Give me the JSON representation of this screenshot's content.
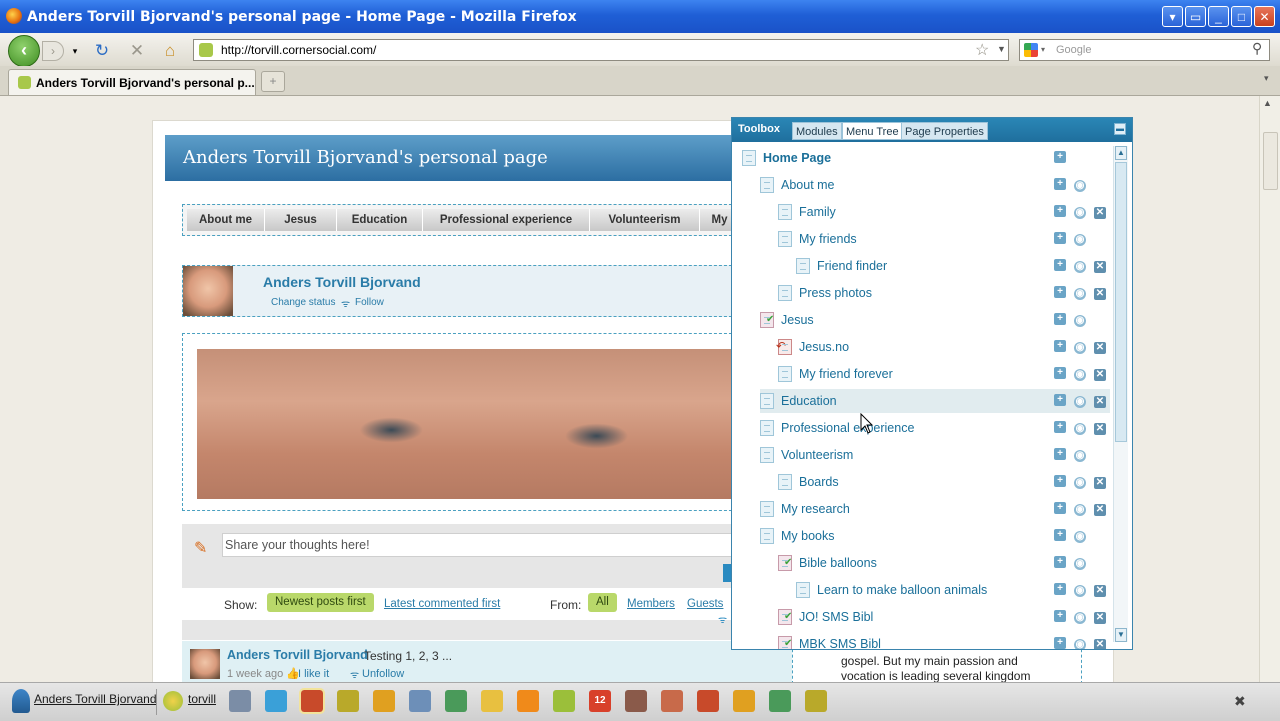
{
  "window": {
    "title": "Anders Torvill Bjorvand's personal page - Home Page - Mozilla Firefox"
  },
  "nav": {
    "url": "http://torvill.cornersocial.com/",
    "search_placeholder": "Google"
  },
  "tabs": [
    {
      "label": "Anders Torvill Bjorvand's personal p..."
    }
  ],
  "page": {
    "banner_title": "Anders Torvill Bjorvand's personal page",
    "menu": [
      "About me",
      "Jesus",
      "Education",
      "Professional experience",
      "Volunteerism",
      "My"
    ],
    "profile": {
      "name": "Anders Torvill Bjorvand",
      "change_status": "Change status",
      "follow": "Follow"
    },
    "share_placeholder": "Share your thoughts here!",
    "filter": {
      "show_label": "Show:",
      "newest": "Newest posts first",
      "latest_commented": "Latest commented first",
      "from_label": "From:",
      "all": "All",
      "members": "Members",
      "guests": "Guests"
    },
    "post": {
      "author": "Anders Torvill Bjorvand",
      "text": "Testing 1, 2, 3 ...",
      "time": "1 week ago",
      "like": "I like it",
      "unfollow": "Unfollow"
    },
    "side_text": [
      "gospel. But my main passion and",
      "vocation is leading several kingdom"
    ]
  },
  "toolbox": {
    "title": "Toolbox",
    "tabs": [
      "Modules",
      "Menu Tree",
      "Page Properties"
    ],
    "tree": [
      {
        "label": "Home Page",
        "level": 0,
        "icon": "page-icon",
        "actions": [
          "add"
        ]
      },
      {
        "label": "About me",
        "level": 1,
        "icon": "page-icon",
        "actions": [
          "add",
          "view"
        ]
      },
      {
        "label": "Family",
        "level": 2,
        "icon": "page-icon",
        "actions": [
          "add",
          "view",
          "delete"
        ]
      },
      {
        "label": "My friends",
        "level": 2,
        "icon": "page-icon",
        "actions": [
          "add",
          "view"
        ]
      },
      {
        "label": "Friend finder",
        "level": 3,
        "icon": "page-icon",
        "actions": [
          "add",
          "view",
          "delete"
        ]
      },
      {
        "label": "Press photos",
        "level": 2,
        "icon": "page-icon",
        "actions": [
          "add",
          "view",
          "delete"
        ]
      },
      {
        "label": "Jesus",
        "level": 1,
        "icon": "checked-page-icon",
        "actions": [
          "add",
          "view"
        ]
      },
      {
        "label": "Jesus.no",
        "level": 2,
        "icon": "link-page-icon",
        "actions": [
          "add",
          "view",
          "delete"
        ]
      },
      {
        "label": "My friend forever",
        "level": 2,
        "icon": "page-icon",
        "actions": [
          "add",
          "view",
          "delete"
        ]
      },
      {
        "label": "Education",
        "level": 1,
        "icon": "page-icon",
        "actions": [
          "add",
          "view",
          "delete"
        ],
        "highlighted": true
      },
      {
        "label": "Professional experience",
        "level": 1,
        "icon": "page-icon",
        "actions": [
          "add",
          "view",
          "delete"
        ]
      },
      {
        "label": "Volunteerism",
        "level": 1,
        "icon": "page-icon",
        "actions": [
          "add",
          "view"
        ]
      },
      {
        "label": "Boards",
        "level": 2,
        "icon": "page-icon",
        "actions": [
          "add",
          "view",
          "delete"
        ]
      },
      {
        "label": "My research",
        "level": 1,
        "icon": "page-icon",
        "actions": [
          "add",
          "view",
          "delete"
        ]
      },
      {
        "label": "My books",
        "level": 1,
        "icon": "page-icon",
        "actions": [
          "add",
          "view"
        ]
      },
      {
        "label": "Bible balloons",
        "level": 2,
        "icon": "checked-page-icon",
        "actions": [
          "add",
          "view"
        ]
      },
      {
        "label": "Learn to make balloon animals",
        "level": 3,
        "icon": "page-icon",
        "actions": [
          "add",
          "view",
          "delete"
        ]
      },
      {
        "label": "JO! SMS Bibl",
        "level": 2,
        "icon": "checked-page-icon",
        "actions": [
          "add",
          "view",
          "delete"
        ]
      },
      {
        "label": "MBK SMS Bibl",
        "level": 2,
        "icon": "checked-page-icon",
        "actions": [
          "add",
          "view",
          "delete"
        ]
      }
    ]
  },
  "statusbar": {
    "user": "Anders Torvill Bjorvand",
    "site": "torvill",
    "icons": [
      "network-icon",
      "cube-icon",
      "layout-icon",
      "notebook-icon",
      "pencil-icon",
      "window-icon",
      "image-icon",
      "folder-icon",
      "rss-icon",
      "checklist-icon",
      "calendar-icon",
      "filmstrip-icon",
      "people-icon",
      "layout-icon",
      "pencil-icon",
      "image-icon",
      "notebook-icon"
    ],
    "calendar_day": "12"
  },
  "colors": {
    "accent": "#2a7ca8",
    "toolbox_header": "#2a86b6",
    "green_pill": "#b9d86a"
  }
}
